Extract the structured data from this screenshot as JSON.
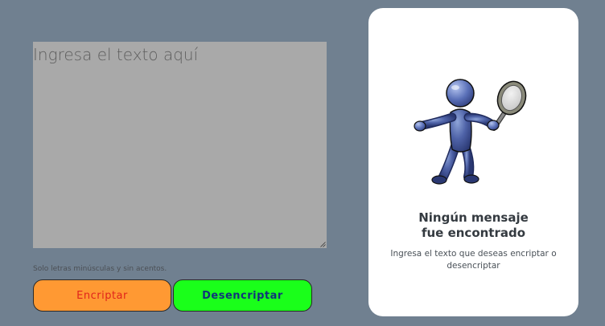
{
  "input": {
    "placeholder": "Ingresa el texto aquí",
    "value": ""
  },
  "hint": {
    "text": "Solo letras minúsculas y sin acentos."
  },
  "buttons": {
    "encrypt_label": "Encriptar",
    "decrypt_label": "Desencriptar"
  },
  "result": {
    "title_line1": "Ningún mensaje",
    "title_line2": "fue encontrado",
    "description": "Ingresa el texto que deseas encriptar o desencriptar",
    "illustration_icon": "person-with-magnifying-glass-icon"
  },
  "colors": {
    "background": "#708090",
    "textarea": "#a9a9a9",
    "encrypt_button": "#ff9933",
    "encrypt_text": "#e0241b",
    "decrypt_button": "#1aff1a",
    "decrypt_text": "#10357a",
    "card": "#ffffff"
  }
}
